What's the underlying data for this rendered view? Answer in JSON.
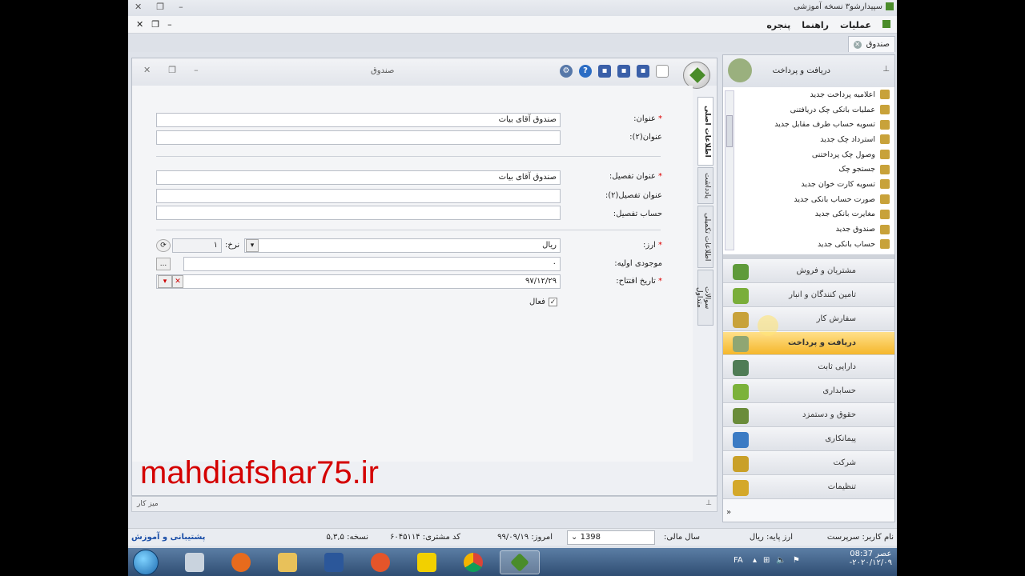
{
  "window": {
    "title": "سپیدارشو۳ نسخه آموزشی",
    "menu": [
      "عملیات",
      "راهنما",
      "پنجره"
    ],
    "doc_tab": "صندوق"
  },
  "document": {
    "title": "صندوق",
    "tabs": [
      "اطلاعات اصلی",
      "یادداشت",
      "اطلاعات تکمیلی",
      "سوالات متداول"
    ],
    "fields": {
      "title_label": "عنوان:",
      "title_value": "صندوق آقای بیات",
      "title2_label": "عنوان(۲):",
      "title2_value": "",
      "detail_title_label": "عنوان تفصیل:",
      "detail_title_value": "صندوق آقای بیات",
      "detail_title2_label": "عنوان تفصیل(۲):",
      "detail_title2_value": "",
      "detail_account_label": "حساب تفصیل:",
      "detail_account_value": "",
      "currency_label": "ارز:",
      "currency_value": "ریال",
      "rate_label": "نرخ:",
      "rate_value": "۱",
      "initial_balance_label": "موجودی اولیه:",
      "initial_balance_value": "۰",
      "opening_date_label": "تاریخ افتتاح:",
      "opening_date_value": "۹۷/۱۲/۲۹",
      "active_label": "فعال",
      "active_checked": true,
      "required_mark": "*",
      "browse_button": "..."
    }
  },
  "watermark": "mahdiafshar75.ir",
  "desk_bar": "میز کار",
  "nav_panel": {
    "title": "دریافت و پرداخت",
    "tasks": [
      "اعلامیه پرداخت جدید",
      "عملیات بانکی چک دریافتنی",
      "تسویه حساب طرف مقابل جدید",
      "استرداد چک جدید",
      "وصول چک پرداختنی",
      "جستجو چک",
      "تسویه کارت خوان جدید",
      "صورت حساب بانکی جدید",
      "مغایرت بانکی جدید",
      "صندوق جدید",
      "حساب بانکی جدید"
    ],
    "modules": [
      {
        "label": "مشتریان و فروش",
        "color": "#5e9a3a",
        "active": false
      },
      {
        "label": "تامین کنندگان و انبار",
        "color": "#7aae3a",
        "active": false
      },
      {
        "label": "سفارش کار",
        "color": "#c8a23a",
        "active": false
      },
      {
        "label": "دریافت و پرداخت",
        "color": "#8fa673",
        "active": true
      },
      {
        "label": "دارایی ثابت",
        "color": "#4f7c55",
        "active": false
      },
      {
        "label": "حسابداری",
        "color": "#7bb23a",
        "active": false
      },
      {
        "label": "حقوق و دستمزد",
        "color": "#6a8c3a",
        "active": false
      },
      {
        "label": "پیمانکاری",
        "color": "#3b7bc4",
        "active": false
      },
      {
        "label": "شرکت",
        "color": "#c9a028",
        "active": false
      },
      {
        "label": "تنظیمات",
        "color": "#d4a82a",
        "active": false
      }
    ]
  },
  "status": {
    "user_label": "نام کاربر:",
    "user_value": "سرپرست",
    "base_currency_label": "ارز پایه:",
    "base_currency_value": "ریال",
    "fiscal_year_label": "سال مالی:",
    "fiscal_year_value": "1398",
    "today_label": "امروز:",
    "today_value": "۹۹/۰۹/۱۹",
    "customer_code_label": "کد مشتری:",
    "customer_code_value": "۶۰۴۵۱۱۴",
    "version_label": "نسخه:",
    "version_value": "۵,۳,۵",
    "support_link": "پشتیبانی و آموزش"
  },
  "taskbar": {
    "lang": "FA",
    "time": "عصر 08:37",
    "date": "۲۰۲۰/۱۲/۰۹-"
  }
}
